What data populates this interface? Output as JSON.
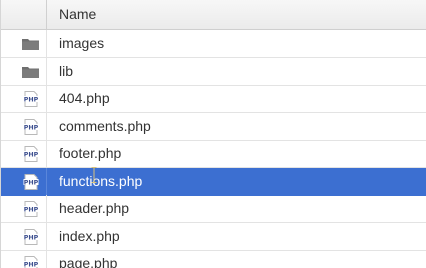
{
  "header": {
    "column_name": "Name"
  },
  "rows": [
    {
      "name": "images",
      "type": "folder",
      "icon": "folder-icon"
    },
    {
      "name": "lib",
      "type": "folder",
      "icon": "folder-icon"
    },
    {
      "name": "404.php",
      "type": "php",
      "icon": "php-file-icon",
      "icon_text": "PHP"
    },
    {
      "name": "comments.php",
      "type": "php",
      "icon": "php-file-icon",
      "icon_text": "PHP"
    },
    {
      "name": "footer.php",
      "type": "php",
      "icon": "php-file-icon",
      "icon_text": "PHP"
    },
    {
      "name": "functions.php",
      "type": "php",
      "icon": "php-file-icon",
      "icon_text": "PHP",
      "selected": true
    },
    {
      "name": "header.php",
      "type": "php",
      "icon": "php-file-icon",
      "icon_text": "PHP"
    },
    {
      "name": "index.php",
      "type": "php",
      "icon": "php-file-icon",
      "icon_text": "PHP"
    },
    {
      "name": "page.php",
      "type": "php",
      "icon": "php-file-icon",
      "icon_text": "PHP"
    }
  ],
  "colors": {
    "selection": "#3c6fd1",
    "folder": "#6f6f6f",
    "php_icon": "#3d4f8f"
  }
}
